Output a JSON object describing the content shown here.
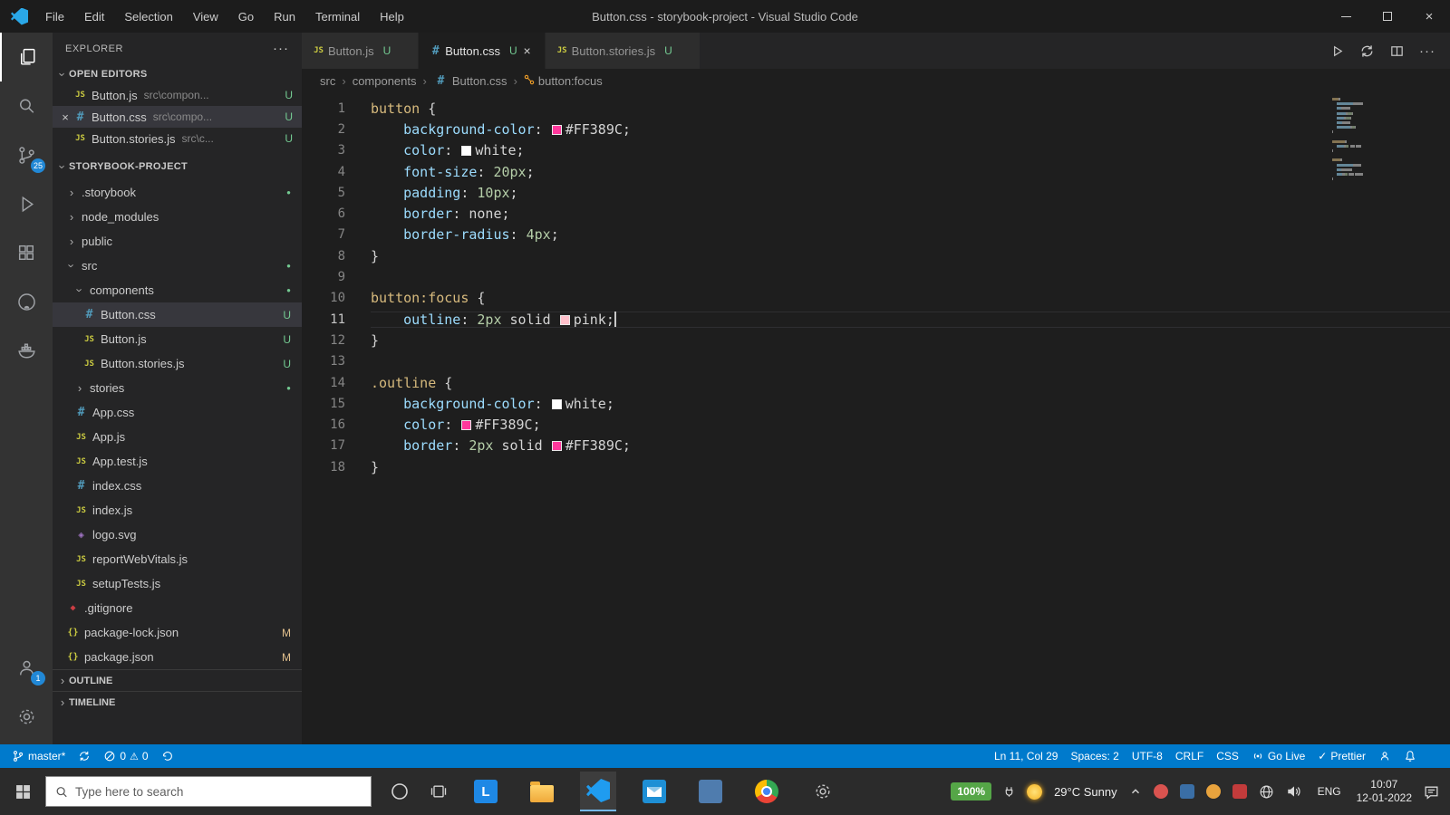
{
  "window": {
    "title": "Button.css - storybook-project - Visual Studio Code",
    "menu": [
      "File",
      "Edit",
      "Selection",
      "View",
      "Go",
      "Run",
      "Terminal",
      "Help"
    ]
  },
  "icons": {
    "close": "×",
    "more": "···",
    "chevron": "›",
    "dot": "●",
    "check": "✓",
    "warning": "⚠",
    "glyphs": {
      "js": "JS",
      "css": "#",
      "json": "{}",
      "git": "◆",
      "svg": "◈",
      "l_app": "L"
    }
  },
  "activity": {
    "scm_badge": "25",
    "account_badge": "1"
  },
  "sidebar": {
    "header": "EXPLORER",
    "sections": {
      "open_editors": "OPEN EDITORS",
      "project": "STORYBOOK-PROJECT",
      "outline": "OUTLINE",
      "timeline": "TIMELINE"
    },
    "open_editors": [
      {
        "icon": "js",
        "name": "Button.js",
        "path": "src\\compon...",
        "badge": "U",
        "active": false
      },
      {
        "icon": "css",
        "name": "Button.css",
        "path": "src\\compo...",
        "badge": "U",
        "active": true
      },
      {
        "icon": "js",
        "name": "Button.stories.js",
        "path": "src\\c...",
        "badge": "U",
        "active": false
      }
    ],
    "tree": [
      {
        "kind": "folder",
        "name": ".storybook",
        "depth": 0,
        "expanded": false,
        "dot": true
      },
      {
        "kind": "folder",
        "name": "node_modules",
        "depth": 0,
        "expanded": false,
        "dot": false
      },
      {
        "kind": "folder",
        "name": "public",
        "depth": 0,
        "expanded": false,
        "dot": false
      },
      {
        "kind": "folder",
        "name": "src",
        "depth": 0,
        "expanded": true,
        "dot": true
      },
      {
        "kind": "folder",
        "name": "components",
        "depth": 1,
        "expanded": true,
        "dot": true
      },
      {
        "kind": "file",
        "icon": "css",
        "name": "Button.css",
        "depth": 2,
        "badge": "U",
        "selected": true
      },
      {
        "kind": "file",
        "icon": "js",
        "name": "Button.js",
        "depth": 2,
        "badge": "U"
      },
      {
        "kind": "file",
        "icon": "js",
        "name": "Button.stories.js",
        "depth": 2,
        "badge": "U"
      },
      {
        "kind": "folder",
        "name": "stories",
        "depth": 1,
        "expanded": false,
        "dot": true
      },
      {
        "kind": "file",
        "icon": "css",
        "name": "App.css",
        "depth": 1
      },
      {
        "kind": "file",
        "icon": "js",
        "name": "App.js",
        "depth": 1
      },
      {
        "kind": "file",
        "icon": "js",
        "name": "App.test.js",
        "depth": 1
      },
      {
        "kind": "file",
        "icon": "css",
        "name": "index.css",
        "depth": 1
      },
      {
        "kind": "file",
        "icon": "js",
        "name": "index.js",
        "depth": 1
      },
      {
        "kind": "file",
        "icon": "svg",
        "name": "logo.svg",
        "depth": 1
      },
      {
        "kind": "file",
        "icon": "js",
        "name": "reportWebVitals.js",
        "depth": 1
      },
      {
        "kind": "file",
        "icon": "js",
        "name": "setupTests.js",
        "depth": 1
      },
      {
        "kind": "file",
        "icon": "git",
        "name": ".gitignore",
        "depth": 0
      },
      {
        "kind": "file",
        "icon": "json",
        "name": "package-lock.json",
        "depth": 0,
        "badge": "M"
      },
      {
        "kind": "file",
        "icon": "json",
        "name": "package.json",
        "depth": 0,
        "badge": "M"
      }
    ]
  },
  "tabs": [
    {
      "icon": "js",
      "label": "Button.js",
      "badge": "U",
      "active": false
    },
    {
      "icon": "css",
      "label": "Button.css",
      "badge": "U",
      "active": true
    },
    {
      "icon": "js",
      "label": "Button.stories.js",
      "badge": "U",
      "active": false
    }
  ],
  "breadcrumb": [
    {
      "label": "src"
    },
    {
      "label": "components"
    },
    {
      "label": "Button.css",
      "icon": "css"
    },
    {
      "label": "button:focus",
      "icon": "symbol"
    }
  ],
  "code": {
    "colors": {
      "sel": "#d7ba7d",
      "prop": "#9cdcfe",
      "val": "#d4d4d4",
      "num": "#b5cea8",
      "pl": "#d4d4d4"
    },
    "lines": [
      {
        "n": "1",
        "t": [
          [
            "sel",
            "button"
          ],
          [
            "pl",
            " {"
          ]
        ]
      },
      {
        "n": "2",
        "t": [
          [
            "pl",
            "    "
          ],
          [
            "prop",
            "background-color"
          ],
          [
            "pl",
            ": "
          ],
          [
            "sw",
            "#FF389C"
          ],
          [
            "val",
            "#FF389C"
          ],
          [
            "pl",
            ";"
          ]
        ]
      },
      {
        "n": "3",
        "t": [
          [
            "pl",
            "    "
          ],
          [
            "prop",
            "color"
          ],
          [
            "pl",
            ": "
          ],
          [
            "sw",
            "#FFFFFF"
          ],
          [
            "val",
            "white"
          ],
          [
            "pl",
            ";"
          ]
        ]
      },
      {
        "n": "4",
        "t": [
          [
            "pl",
            "    "
          ],
          [
            "prop",
            "font-size"
          ],
          [
            "pl",
            ": "
          ],
          [
            "num",
            "20px"
          ],
          [
            "pl",
            ";"
          ]
        ]
      },
      {
        "n": "5",
        "t": [
          [
            "pl",
            "    "
          ],
          [
            "prop",
            "padding"
          ],
          [
            "pl",
            ": "
          ],
          [
            "num",
            "10px"
          ],
          [
            "pl",
            ";"
          ]
        ]
      },
      {
        "n": "6",
        "t": [
          [
            "pl",
            "    "
          ],
          [
            "prop",
            "border"
          ],
          [
            "pl",
            ": "
          ],
          [
            "val",
            "none"
          ],
          [
            "pl",
            ";"
          ]
        ]
      },
      {
        "n": "7",
        "t": [
          [
            "pl",
            "    "
          ],
          [
            "prop",
            "border-radius"
          ],
          [
            "pl",
            ": "
          ],
          [
            "num",
            "4px"
          ],
          [
            "pl",
            ";"
          ]
        ]
      },
      {
        "n": "8",
        "t": [
          [
            "pl",
            "}"
          ]
        ]
      },
      {
        "n": "9",
        "t": []
      },
      {
        "n": "10",
        "t": [
          [
            "sel",
            "button:focus"
          ],
          [
            "pl",
            " {"
          ]
        ]
      },
      {
        "n": "11",
        "current": true,
        "t": [
          [
            "pl",
            "    "
          ],
          [
            "prop",
            "outline"
          ],
          [
            "pl",
            ": "
          ],
          [
            "num",
            "2px"
          ],
          [
            "pl",
            " "
          ],
          [
            "val",
            "solid"
          ],
          [
            "pl",
            " "
          ],
          [
            "sw",
            "#FFC0CB"
          ],
          [
            "val",
            "pink"
          ],
          [
            "pl",
            ";"
          ],
          [
            "cur",
            ""
          ]
        ]
      },
      {
        "n": "12",
        "t": [
          [
            "pl",
            "}"
          ]
        ]
      },
      {
        "n": "13",
        "t": []
      },
      {
        "n": "14",
        "t": [
          [
            "sel",
            ".outline"
          ],
          [
            "pl",
            " {"
          ]
        ]
      },
      {
        "n": "15",
        "t": [
          [
            "pl",
            "    "
          ],
          [
            "prop",
            "background-color"
          ],
          [
            "pl",
            ": "
          ],
          [
            "sw",
            "#FFFFFF"
          ],
          [
            "val",
            "white"
          ],
          [
            "pl",
            ";"
          ]
        ]
      },
      {
        "n": "16",
        "t": [
          [
            "pl",
            "    "
          ],
          [
            "prop",
            "color"
          ],
          [
            "pl",
            ": "
          ],
          [
            "sw",
            "#FF389C"
          ],
          [
            "val",
            "#FF389C"
          ],
          [
            "pl",
            ";"
          ]
        ]
      },
      {
        "n": "17",
        "t": [
          [
            "pl",
            "    "
          ],
          [
            "prop",
            "border"
          ],
          [
            "pl",
            ": "
          ],
          [
            "num",
            "2px"
          ],
          [
            "pl",
            " "
          ],
          [
            "val",
            "solid"
          ],
          [
            "pl",
            " "
          ],
          [
            "sw",
            "#FF389C"
          ],
          [
            "val",
            "#FF389C"
          ],
          [
            "pl",
            ";"
          ]
        ]
      },
      {
        "n": "18",
        "t": [
          [
            "pl",
            "}"
          ]
        ]
      }
    ]
  },
  "status": {
    "branch": "master*",
    "errors": "0",
    "warnings": "0",
    "line_col": "Ln 11, Col 29",
    "spaces": "Spaces: 2",
    "encoding": "UTF-8",
    "eol": "CRLF",
    "language": "CSS",
    "go_live": "Go Live",
    "prettier": "Prettier"
  },
  "taskbar": {
    "search_placeholder": "Type here to search",
    "battery": "100%",
    "weather": "29°C Sunny",
    "language": "ENG",
    "time": "10:07",
    "date": "12-01-2022"
  }
}
